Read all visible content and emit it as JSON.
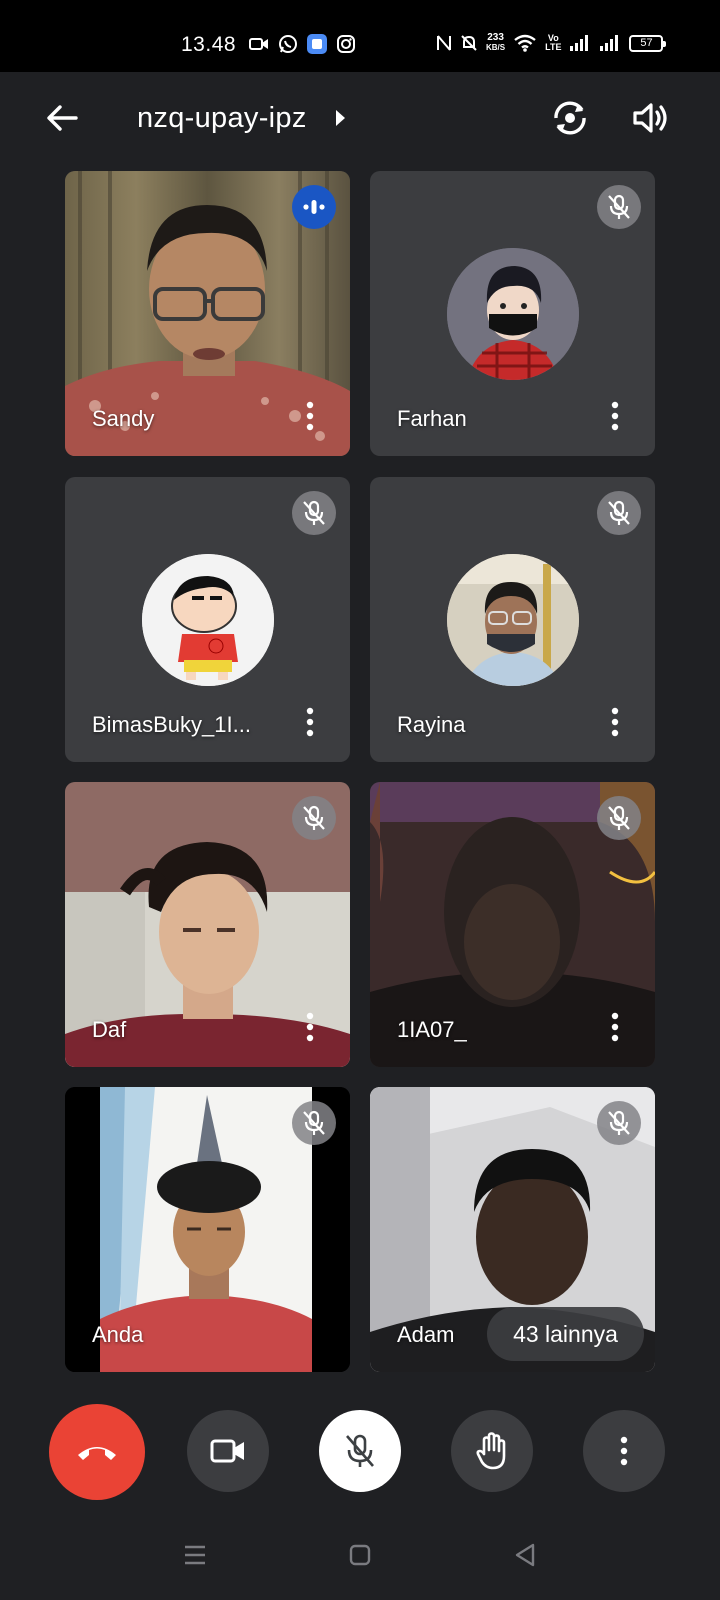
{
  "status_bar": {
    "time": "13.48",
    "net_speed_value": "233",
    "net_speed_unit": "KB/S",
    "volte_top": "Vo",
    "volte_bottom": "LTE",
    "battery": "57"
  },
  "header": {
    "meeting_code": "nzq-upay-ipz"
  },
  "participants": [
    {
      "name": "Sandy",
      "state": "speaking"
    },
    {
      "name": "Farhan",
      "state": "muted"
    },
    {
      "name": "BimasBuky_1I...",
      "state": "muted"
    },
    {
      "name": "Rayina",
      "state": "muted"
    },
    {
      "name": "Daf",
      "state": "muted"
    },
    {
      "name": "1IA07_",
      "state": "muted"
    },
    {
      "name": "Anda",
      "state": "muted"
    },
    {
      "name": "Adam",
      "state": "muted"
    }
  ],
  "overflow": {
    "label": "43 lainnya"
  },
  "controls": {
    "end_call": "end-call-icon",
    "camera": "video-camera-icon",
    "mic": "mic-off-icon",
    "raise_hand": "raise-hand-icon",
    "more": "more-vert-icon"
  },
  "colors": {
    "background": "#1f2023",
    "tile": "#3c3d40",
    "end_call": "#ea4335",
    "speaking": "#1a56c4"
  }
}
